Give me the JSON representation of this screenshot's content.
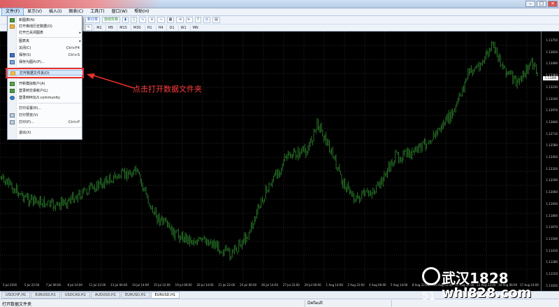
{
  "menubar": {
    "items": [
      "文件(F)",
      "显示(V)",
      "插入(I)",
      "图表(C)",
      "工具(T)",
      "窗口(W)",
      "帮助(H)"
    ]
  },
  "toolbar": {
    "new_order_label": "新订单",
    "autotrade_label": "自动交易",
    "timeframes": [
      "M1",
      "M5",
      "M15",
      "M30",
      "H1",
      "H4",
      "D1",
      "W1",
      "MN"
    ]
  },
  "file_menu": {
    "items": [
      {
        "label": "新图表(N)",
        "shortcut": "",
        "icon": "new-chart-icon"
      },
      {
        "label": "打开离线历史数据(O)",
        "shortcut": "",
        "icon": "open-offline-icon"
      },
      {
        "label": "打开已关闭图表",
        "shortcut": "",
        "icon": "",
        "submenu": true
      },
      {
        "label": "图表夹",
        "shortcut": "",
        "icon": "",
        "submenu": true
      },
      {
        "label": "关闭(C)",
        "shortcut": "Ctrl+F4",
        "icon": ""
      },
      {
        "label": "保存(S)",
        "shortcut": "Ctrl+S",
        "icon": "save-icon"
      },
      {
        "label": "保存为图片(P)...",
        "shortcut": "",
        "icon": "save-image-icon"
      },
      {
        "label": "打开数据文件夹(D)",
        "shortcut": "",
        "icon": "folder-icon",
        "highlighted": true
      },
      {
        "label": "开新模拟帐户(A)",
        "shortcut": "",
        "icon": "demo-account-icon"
      },
      {
        "label": "登录到交易帐户(L)",
        "shortcut": "",
        "icon": "login-icon"
      },
      {
        "label": "登录到MQL5.community",
        "shortcut": "",
        "icon": "mql5-icon"
      },
      {
        "label": "打印设置(R)...",
        "shortcut": "",
        "icon": ""
      },
      {
        "label": "打印预览(V)",
        "shortcut": "",
        "icon": "print-preview-icon"
      },
      {
        "label": "打印(P)...",
        "shortcut": "Ctrl+P",
        "icon": "print-icon"
      },
      {
        "label": "退出(X)",
        "shortcut": "",
        "icon": ""
      }
    ]
  },
  "annotation": {
    "text": "点击打开数据文件夹"
  },
  "price_axis": {
    "labels": [
      "1.13750",
      "1.13620",
      "1.13490",
      "1.13360",
      "1.13230",
      "1.13100",
      "1.12970",
      "1.12840",
      "1.12710",
      "1.12580",
      "1.12450",
      "1.12320",
      "1.12190",
      "1.12060",
      "1.11930",
      "1.11800",
      "1.11670",
      "1.11540",
      "1.11410",
      "1.11280",
      "1.11150",
      "1.11020"
    ],
    "current": "1.13390"
  },
  "time_axis": {
    "labels": [
      "5 Jul 2016",
      "5 Jul 22:00",
      "7 Jul 06:00",
      "8 Jul 14:00",
      "11 Jul 22:00",
      "13 Jul 06:00",
      "14 Jul 14:00",
      "15 Jul 22:00",
      "19 Jul 06:00",
      "20 Jul 14:00",
      "21 Jul 22:00",
      "25 Jul 06:00",
      "26 Jul 14:00",
      "27 Jul 22:00",
      "29 Jul 06:00",
      "1 Aug 14:00",
      "2 Aug 22:00",
      "4 Aug 06:00",
      "5 Aug 14:00",
      "8 Aug 22:00",
      "10 Aug 06:00",
      "11 Aug 14:00",
      "12 Aug 22:00",
      "16 Aug 06:00",
      "17 Aug 14:00"
    ]
  },
  "tabs": [
    "USDCHF,H1",
    "EURUSD,H1",
    "USDCAD,H1",
    "AUDUSD,H1",
    "EURUSD,H1",
    "EURUSD,H1"
  ],
  "status": {
    "left": "打开数据文件夹",
    "profile": "Default"
  },
  "watermark": {
    "line1": "武汉1828",
    "line2": "whl828.com",
    "num": "51"
  },
  "colors": {
    "candle": "#2e8b2e",
    "highlight": "#e8312f",
    "annotation": "#ff3b3b"
  }
}
